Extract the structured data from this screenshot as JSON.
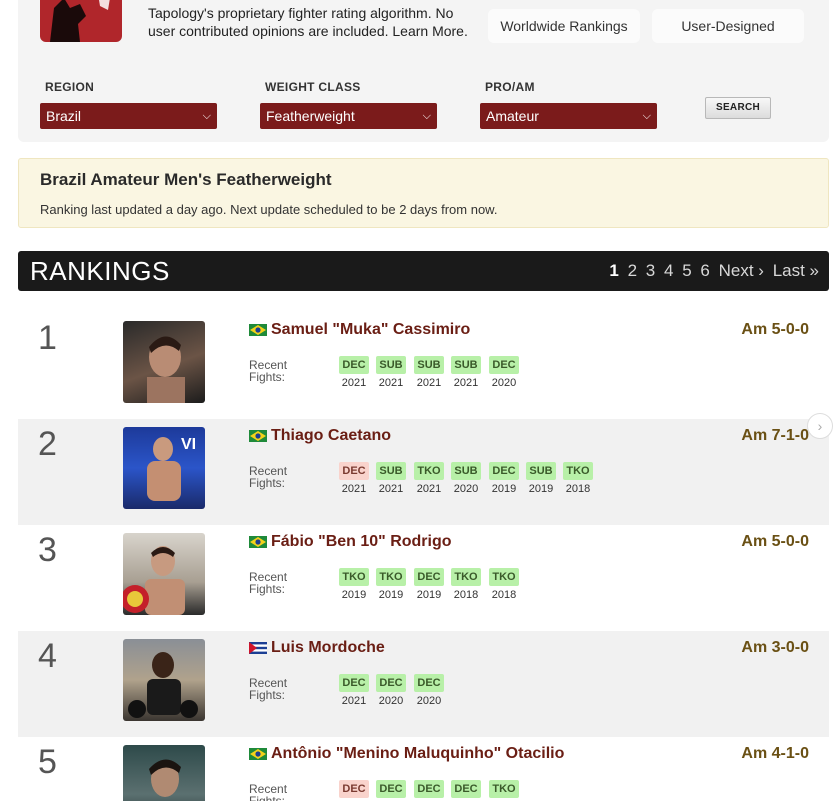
{
  "header": {
    "intro": "Tapology's proprietary fighter rating algorithm. No user contributed opinions are included. Learn More.",
    "tabs": [
      "Worldwide Rankings",
      "User-Designed"
    ]
  },
  "filters": {
    "region_label": "REGION",
    "region_value": "Brazil",
    "weight_label": "WEIGHT CLASS",
    "weight_value": "Featherweight",
    "proam_label": "PRO/AM",
    "proam_value": "Amateur",
    "search_label": "SEARCH"
  },
  "banner": {
    "title": "Brazil Amateur Men's Featherweight",
    "subtitle": "Ranking last updated a day ago. Next update scheduled to be 2 days from now."
  },
  "rankings": {
    "title": "RANKINGS",
    "pages": [
      "1",
      "2",
      "3",
      "4",
      "5",
      "6"
    ],
    "current_page": "1",
    "next": "Next ›",
    "last": "Last »",
    "recent_label_1": "Recent",
    "recent_label_2": "Fights:"
  },
  "fighters": [
    {
      "rank": "1",
      "name": "Samuel \"Muka\" Cassimiro",
      "country": "Brazil",
      "record": "Am 5-0-0",
      "fights": [
        {
          "m": "DEC",
          "y": "2021",
          "r": "win"
        },
        {
          "m": "SUB",
          "y": "2021",
          "r": "win"
        },
        {
          "m": "SUB",
          "y": "2021",
          "r": "win"
        },
        {
          "m": "SUB",
          "y": "2021",
          "r": "win"
        },
        {
          "m": "DEC",
          "y": "2020",
          "r": "win"
        }
      ]
    },
    {
      "rank": "2",
      "name": "Thiago Caetano",
      "country": "Brazil",
      "record": "Am 7-1-0",
      "fights": [
        {
          "m": "DEC",
          "y": "2021",
          "r": "loss"
        },
        {
          "m": "SUB",
          "y": "2021",
          "r": "win"
        },
        {
          "m": "TKO",
          "y": "2021",
          "r": "win"
        },
        {
          "m": "SUB",
          "y": "2020",
          "r": "win"
        },
        {
          "m": "DEC",
          "y": "2019",
          "r": "win"
        },
        {
          "m": "SUB",
          "y": "2019",
          "r": "win"
        },
        {
          "m": "TKO",
          "y": "2018",
          "r": "win"
        }
      ]
    },
    {
      "rank": "3",
      "name": "Fábio \"Ben 10\" Rodrigo",
      "country": "Brazil",
      "record": "Am 5-0-0",
      "fights": [
        {
          "m": "TKO",
          "y": "2019",
          "r": "win"
        },
        {
          "m": "TKO",
          "y": "2019",
          "r": "win"
        },
        {
          "m": "DEC",
          "y": "2019",
          "r": "win"
        },
        {
          "m": "TKO",
          "y": "2018",
          "r": "win"
        },
        {
          "m": "TKO",
          "y": "2018",
          "r": "win"
        }
      ]
    },
    {
      "rank": "4",
      "name": "Luis Mordoche",
      "country": "Cuba",
      "record": "Am 3-0-0",
      "fights": [
        {
          "m": "DEC",
          "y": "2021",
          "r": "win"
        },
        {
          "m": "DEC",
          "y": "2020",
          "r": "win"
        },
        {
          "m": "DEC",
          "y": "2020",
          "r": "win"
        }
      ]
    },
    {
      "rank": "5",
      "name": "Antônio \"Menino Maluquinho\" Otacilio",
      "country": "Brazil",
      "record": "Am 4-1-0",
      "fights": [
        {
          "m": "DEC",
          "y": "",
          "r": "loss"
        },
        {
          "m": "DEC",
          "y": "",
          "r": "win"
        },
        {
          "m": "DEC",
          "y": "",
          "r": "win"
        },
        {
          "m": "DEC",
          "y": "",
          "r": "win"
        },
        {
          "m": "TKO",
          "y": "",
          "r": "win"
        }
      ]
    }
  ],
  "icons": {
    "chevron": "chevron-down-icon",
    "scroll": "chevron-right-icon"
  },
  "colors": {
    "brand": "#b0262b",
    "select_bg": "#7b1b1b",
    "name": "#6a1e14",
    "record": "#6a5014",
    "win": "#b8f0a8",
    "loss": "#f9d3cc"
  }
}
